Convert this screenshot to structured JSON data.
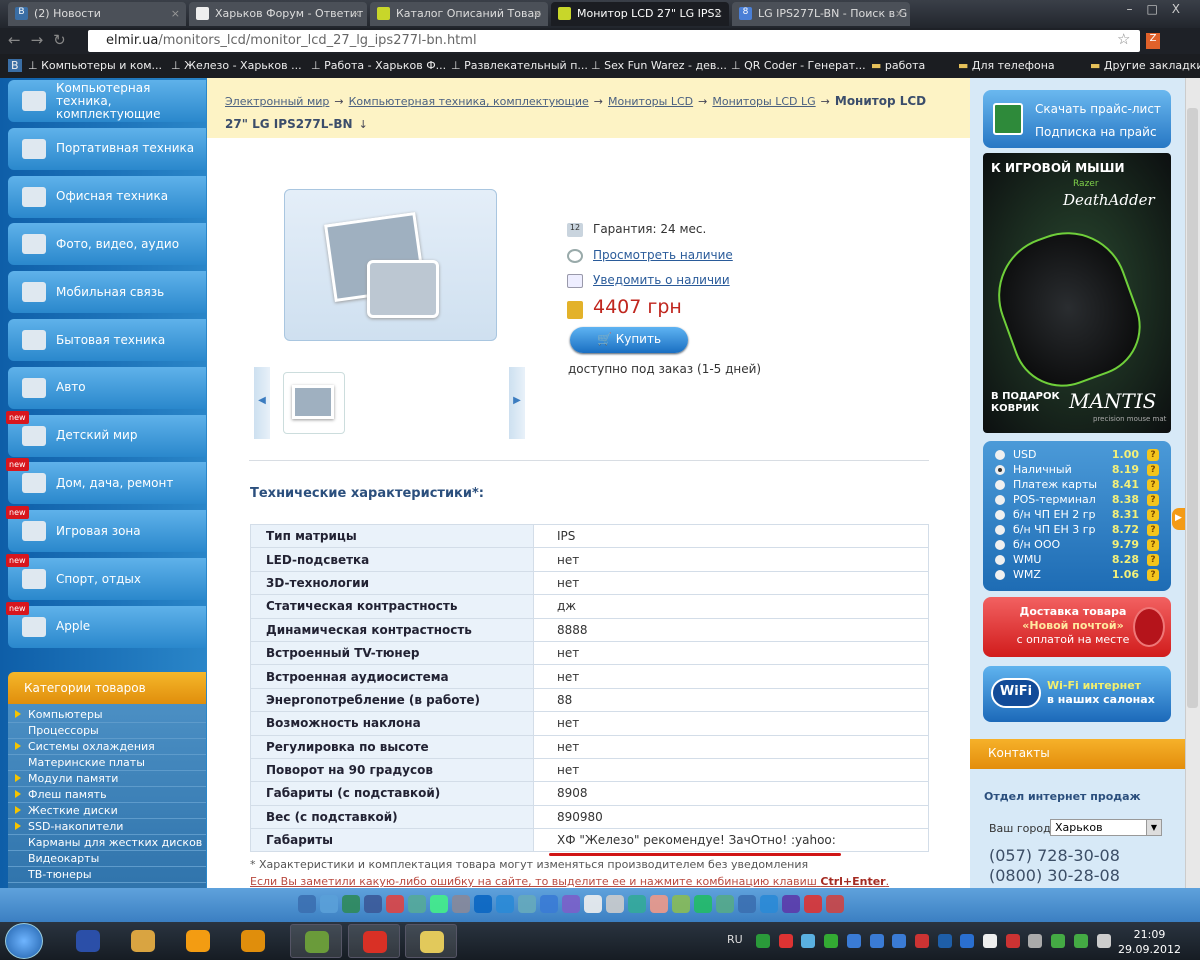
{
  "browser": {
    "tabs": [
      {
        "label": "(2) Новости",
        "color": "#3a6ea5",
        "letter": "B"
      },
      {
        "label": "Харьков Форум - Ответит",
        "color": "#eee",
        "letter": ""
      },
      {
        "label": "Каталог Описаний Товар",
        "color": "#c8d62a",
        "letter": ""
      },
      {
        "label": "Монитор LCD 27\" LG IPS2",
        "color": "#c8d62a",
        "letter": ""
      },
      {
        "label": "LG IPS277L-BN - Поиск в G",
        "color": "#4a7fd6",
        "letter": "8"
      }
    ],
    "url_domain": "elmir.ua",
    "url_path": "/monitors_lcd/monitor_lcd_27_lg_ips277l-bn.html",
    "ext_label": "Z",
    "bookmarks": [
      {
        "label": "Компьютеры и ком..."
      },
      {
        "label": "Железо - Харьков ..."
      },
      {
        "label": "Работа - Харьков Ф..."
      },
      {
        "label": "Развлекательный п..."
      },
      {
        "label": "Sex Fun Warez - дев..."
      },
      {
        "label": "QR Coder - Генерат..."
      },
      {
        "label": "работа"
      },
      {
        "label": "Для телефона"
      }
    ],
    "other_bookmarks": "Другие закладки"
  },
  "sidebar": {
    "menu": [
      {
        "label": "Компьютерная техника, комплектующие",
        "new": false
      },
      {
        "label": "Портативная техника",
        "new": false
      },
      {
        "label": "Офисная техника",
        "new": false
      },
      {
        "label": "Фото, видео, аудио",
        "new": false
      },
      {
        "label": "Мобильная связь",
        "new": false
      },
      {
        "label": "Бытовая техника",
        "new": false
      },
      {
        "label": "Авто",
        "new": false
      },
      {
        "label": "Детский мир",
        "new": true
      },
      {
        "label": "Дом, дача, ремонт",
        "new": true
      },
      {
        "label": "Игровая зона",
        "new": true
      },
      {
        "label": "Спорт, отдых",
        "new": true
      },
      {
        "label": "Apple",
        "new": true
      }
    ],
    "new_badge": "new",
    "categories_title": "Категории товаров",
    "categories": [
      {
        "label": "Компьютеры",
        "arrow": true
      },
      {
        "label": "Процессоры",
        "arrow": false
      },
      {
        "label": "Системы охлаждения",
        "arrow": true
      },
      {
        "label": "Материнские платы",
        "arrow": false
      },
      {
        "label": "Модули памяти",
        "arrow": true
      },
      {
        "label": "Флеш память",
        "arrow": true
      },
      {
        "label": "Жесткие диски",
        "arrow": true
      },
      {
        "label": "SSD-накопители",
        "arrow": true
      },
      {
        "label": "Карманы для жестких дисков",
        "arrow": false
      },
      {
        "label": "Видеокарты",
        "arrow": false
      },
      {
        "label": "ТВ-тюнеры",
        "arrow": false
      }
    ]
  },
  "breadcrumb": {
    "items": [
      "Электронный мир",
      "Компьютерная техника, комплектующие",
      "Мониторы LCD",
      "Мониторы LCD LG"
    ],
    "current": "Монитор LCD 27\" LG IPS277L-BN",
    "sep": "→",
    "down": "↓"
  },
  "product": {
    "warranty": "Гарантия: 24 мес.",
    "check_availability": "Просмотреть наличие",
    "notify": "Уведомить о наличии",
    "price": "4407 грн",
    "buy": "Купить",
    "availability": "доступно под заказ (1-5 дней)",
    "calendar_day": "12"
  },
  "specs": {
    "title": "Технические характеристики*:",
    "rows": [
      [
        "Тип матрицы",
        "IPS"
      ],
      [
        "LED-подсветка",
        "нет"
      ],
      [
        "3D-технологии",
        "нет"
      ],
      [
        "Статическая контрастность",
        "дж"
      ],
      [
        "Динамическая контрастность",
        "8888"
      ],
      [
        "Встроенный TV-тюнер",
        "нет"
      ],
      [
        "Встроенная аудиосистема",
        "нет"
      ],
      [
        "Энергопотребление (в работе)",
        "88"
      ],
      [
        "Возможность наклона",
        "нет"
      ],
      [
        "Регулировка по высоте",
        "нет"
      ],
      [
        "Поворот на 90 градусов",
        "нет"
      ],
      [
        "Габариты (с подставкой)",
        "8908"
      ],
      [
        "Вес (с подставкой)",
        "890980"
      ],
      [
        "Габариты",
        "ХФ \"Железо\" рекомендуе! ЗачОтно! :yahoo:"
      ]
    ],
    "note": "* Характеристики и комплектация товара могут изменяться производителем без уведомления",
    "error_text": "Если Вы заметили какую-либо ошибку на сайте, то выделите ее и нажмите комбинацию клавиш",
    "error_keys": "Ctrl+Enter",
    "error_end": "."
  },
  "right": {
    "price_download": "Скачать прайс-лист",
    "price_subscribe": "Подписка на прайс",
    "ad": {
      "top": "К ИГРОВОЙ МЫШИ",
      "brand": "Razer",
      "product": "DeathAdder",
      "gift": "В ПОДАРОК КОВРИК",
      "mat": "MANTIS",
      "mat_sub": "precision mouse mat"
    },
    "currencies": [
      {
        "name": "USD",
        "value": "1.00",
        "selected": false
      },
      {
        "name": "Наличный",
        "value": "8.19",
        "selected": true
      },
      {
        "name": "Платеж карты",
        "value": "8.41",
        "selected": false
      },
      {
        "name": "POS-терминал",
        "value": "8.38",
        "selected": false
      },
      {
        "name": "б/н ЧП ЕН 2 гр",
        "value": "8.31",
        "selected": false
      },
      {
        "name": "б/н ЧП ЕН 3 гр",
        "value": "8.72",
        "selected": false
      },
      {
        "name": "б/н ООО",
        "value": "9.79",
        "selected": false
      },
      {
        "name": "WMU",
        "value": "8.28",
        "selected": false
      },
      {
        "name": "WMZ",
        "value": "1.06",
        "selected": false
      }
    ],
    "help": "?",
    "delivery": [
      "Доставка товара",
      "«Новой почтой»",
      "с оплатой на месте"
    ],
    "wifi_logo": "WiFi",
    "wifi": [
      "Wi-Fi интернет",
      "в наших салонах"
    ],
    "contacts_title": "Контакты",
    "dept": "Отдел интернет продаж",
    "city_label": "Ваш город",
    "city": "Харьков",
    "phones": [
      "(057) 728-30-08",
      "(0800) 30-28-08"
    ]
  },
  "taskbar": {
    "lang": "RU",
    "time": "21:09",
    "date": "29.09.2012"
  }
}
